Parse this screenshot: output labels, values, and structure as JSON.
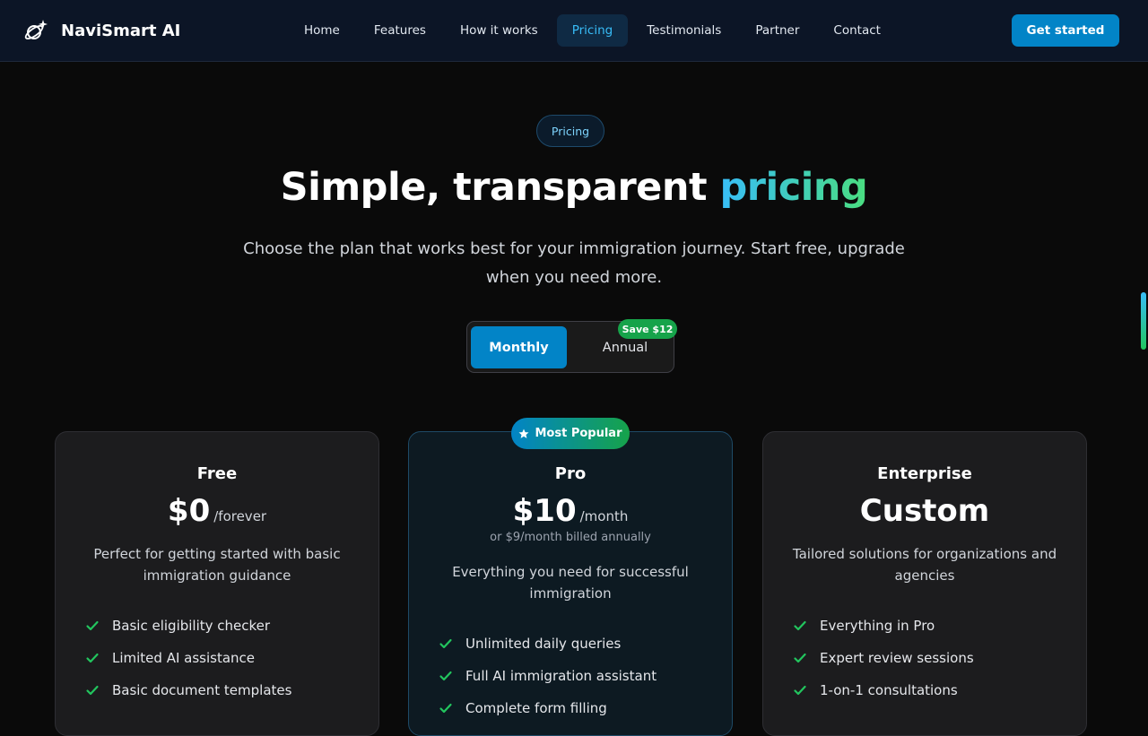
{
  "nav": {
    "brand": "NaviSmart AI",
    "links": [
      {
        "label": "Home"
      },
      {
        "label": "Features"
      },
      {
        "label": "How it works"
      },
      {
        "label": "Pricing",
        "active": true
      },
      {
        "label": "Testimonials"
      },
      {
        "label": "Partner"
      },
      {
        "label": "Contact"
      }
    ],
    "cta": "Get started"
  },
  "hero": {
    "pill": "Pricing",
    "title_main": "Simple, transparent ",
    "title_accent": "pricing",
    "subtitle": "Choose the plan that works best for your immigration journey. Start free, upgrade when you need more."
  },
  "billing_toggle": {
    "monthly": "Monthly",
    "annual": "Annual",
    "save_badge": "Save $12",
    "selected": "Monthly"
  },
  "popular_badge": "Most Popular",
  "plans": [
    {
      "name": "Free",
      "price": "$0",
      "period": "/forever",
      "billed_note": "",
      "description": "Perfect for getting started with basic immigration guidance",
      "features": [
        "Basic eligibility checker",
        "Limited AI assistance",
        "Basic document templates"
      ]
    },
    {
      "name": "Pro",
      "price": "$10",
      "period": "/month",
      "billed_note": "or $9/month billed annually",
      "description": "Everything you need for successful immigration",
      "features": [
        "Unlimited daily queries",
        "Full AI immigration assistant",
        "Complete form filling"
      ]
    },
    {
      "name": "Enterprise",
      "price": "Custom",
      "period": "",
      "billed_note": "",
      "description": "Tailored solutions for organizations and agencies",
      "features": [
        "Everything in Pro",
        "Expert review sessions",
        "1-on-1 consultations"
      ]
    }
  ],
  "colors": {
    "accent": "#0284c7",
    "success": "#22c55e",
    "background": "#0a0a0a"
  }
}
